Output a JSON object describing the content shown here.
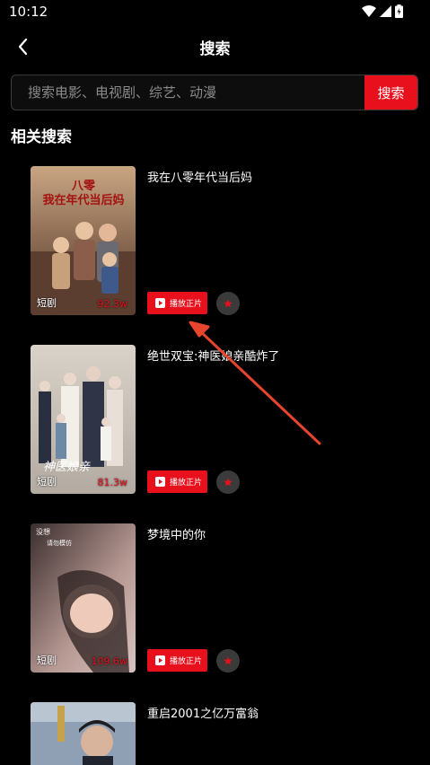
{
  "status_bar": {
    "time": "10:12"
  },
  "header": {
    "title": "搜索"
  },
  "search": {
    "placeholder": "搜索电影、电视剧、综艺、动漫",
    "value": "",
    "button_label": "搜索"
  },
  "section": {
    "title": "相关搜索"
  },
  "results": [
    {
      "title": "我在八零年代当后妈",
      "genre": "短剧",
      "views": "92.3w",
      "play_label": "播放正片",
      "poster_text": "我在八零年代当后妈"
    },
    {
      "title": "绝世双宝:神医娘亲酷炸了",
      "genre": "短剧",
      "views": "81.3w",
      "play_label": "播放正片",
      "poster_text": "绝世双宝神医娘亲"
    },
    {
      "title": "梦境中的你",
      "genre": "短剧",
      "views": "109.6w",
      "play_label": "播放正片",
      "poster_text": ""
    },
    {
      "title": "重启2001之亿万富翁",
      "genre": "",
      "views": "",
      "play_label": "",
      "poster_text": ""
    }
  ],
  "colors": {
    "accent": "#e8101c",
    "background": "#000000",
    "annotation": "#e8452f"
  },
  "icons": [
    "wifi-icon",
    "signal-icon",
    "battery-icon",
    "back-arrow-icon",
    "play-icon",
    "star-icon"
  ]
}
